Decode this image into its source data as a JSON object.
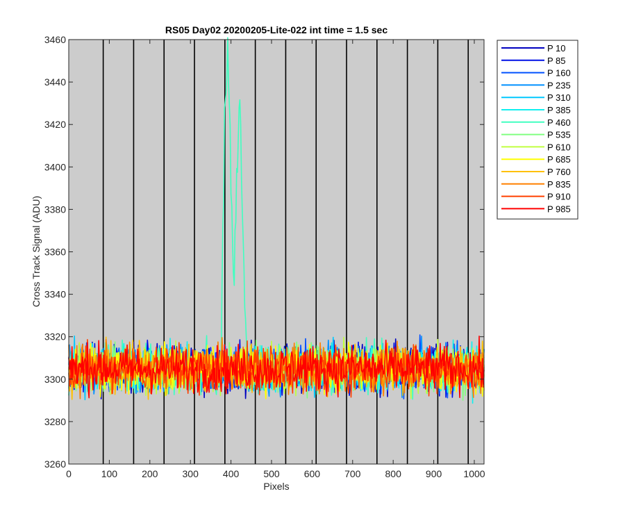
{
  "chart_data": {
    "type": "line",
    "title": "RS05 Day02 20200205-Lite-022 int time = 1.5 sec",
    "xlabel": "Pixels",
    "ylabel": "Cross Track Signal (ADU)",
    "xlim": [
      0,
      1024
    ],
    "ylim": [
      3260,
      3460
    ],
    "xticks": [
      0,
      100,
      200,
      300,
      400,
      500,
      600,
      700,
      800,
      900,
      1000
    ],
    "yticks": [
      3260,
      3280,
      3300,
      3320,
      3340,
      3360,
      3380,
      3400,
      3420,
      3440,
      3460
    ],
    "background_color": "#cccccc",
    "vertical_lines_x": [
      85,
      160,
      235,
      310,
      385,
      460,
      535,
      610,
      685,
      760,
      835,
      910,
      985
    ],
    "vertical_line_color": "#000000",
    "legend_position": "outside-top-right",
    "noise_mean": 3305,
    "noise_range": [
      3276,
      3335
    ],
    "series": [
      {
        "name": "P 10",
        "color": "#0000bf"
      },
      {
        "name": "P 85",
        "color": "#0010e6"
      },
      {
        "name": "P 160",
        "color": "#0050ff"
      },
      {
        "name": "P 235",
        "color": "#0090ff"
      },
      {
        "name": "P 310",
        "color": "#00c8ff"
      },
      {
        "name": "P 385",
        "color": "#10f0f0"
      },
      {
        "name": "P 460",
        "color": "#40ffc0",
        "feature": {
          "type": "double-peak",
          "x_range": [
            377,
            440
          ],
          "peaks": [
            {
              "x": 392,
              "y": 3459
            },
            {
              "x": 423,
              "y": 3450
            }
          ],
          "valley": {
            "x": 407,
            "y": 3340
          },
          "base_y": 3305
        }
      },
      {
        "name": "P 535",
        "color": "#80ff80"
      },
      {
        "name": "P 610",
        "color": "#c0ff40"
      },
      {
        "name": "P 685",
        "color": "#ffff00"
      },
      {
        "name": "P 760",
        "color": "#ffc000"
      },
      {
        "name": "P 835",
        "color": "#ff8000"
      },
      {
        "name": "P 910",
        "color": "#ff4000"
      },
      {
        "name": "P 985",
        "color": "#ff0000"
      }
    ]
  }
}
